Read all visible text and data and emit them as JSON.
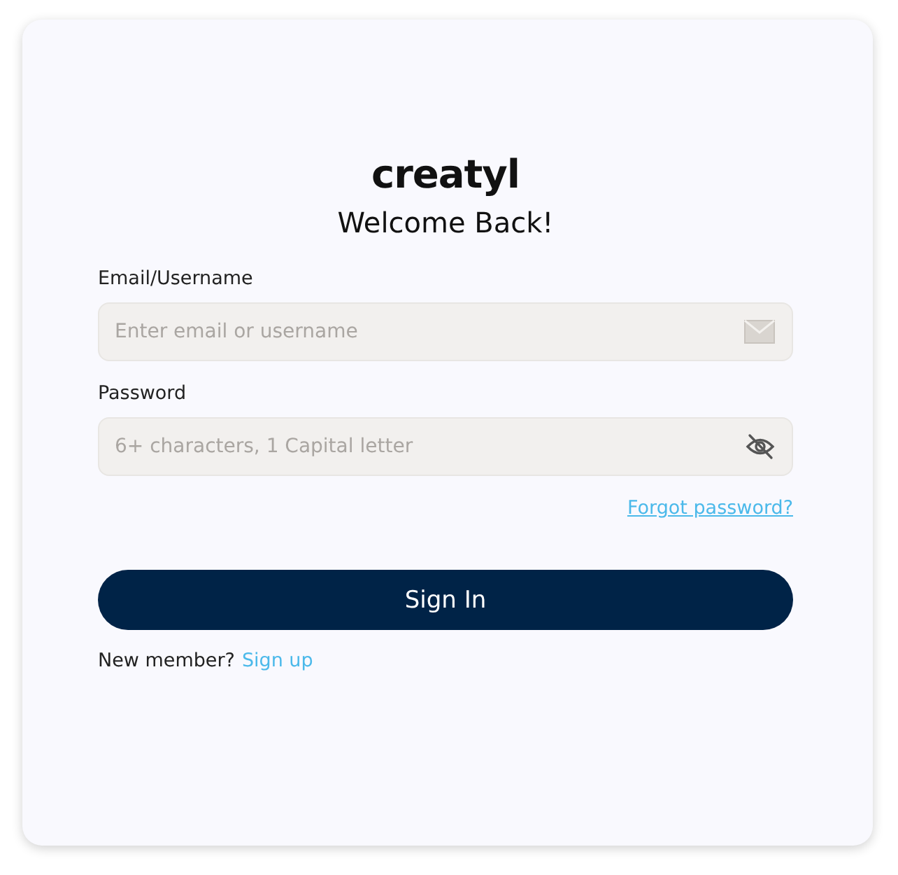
{
  "logo": "creatyl",
  "heading": "Welcome Back!",
  "fields": [
    {
      "kind": "email",
      "label": "Email/Username",
      "placeholder": "Enter email or username"
    },
    {
      "kind": "password",
      "label": "Password",
      "placeholder": "6+ characters, 1 Capital letter"
    }
  ],
  "forgot_link": "Forgot password?",
  "submit_button": "Sign In",
  "signup": {
    "prompt": "New member?",
    "link": "Sign up"
  }
}
